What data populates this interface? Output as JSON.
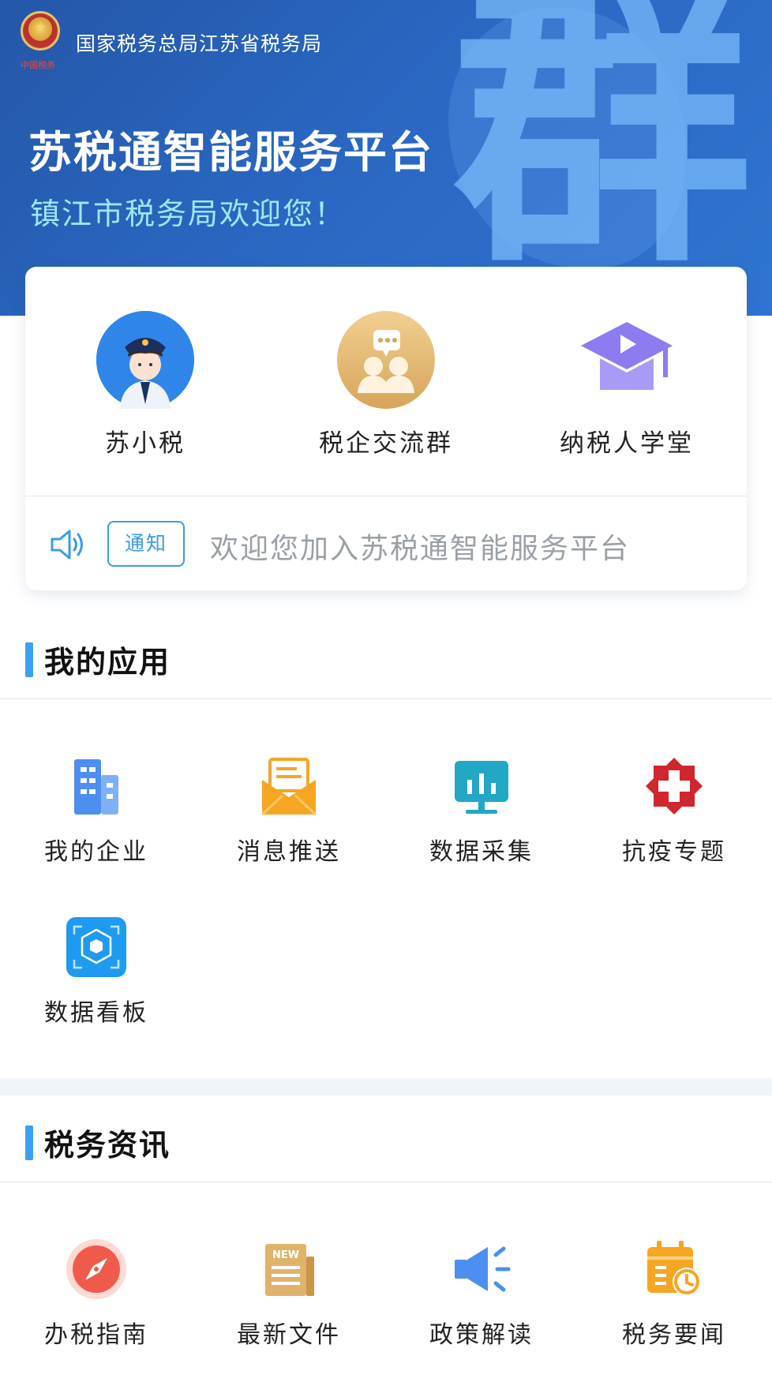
{
  "header": {
    "agency": "国家税务总局江苏省税务局",
    "emblem_caption": "中国税务",
    "platform_title": "苏税通智能服务平台",
    "welcome": "镇江市税务局欢迎您！",
    "deco_char": "群"
  },
  "quick_entries": [
    {
      "label": "苏小税",
      "icon": "tax-officer-avatar-icon"
    },
    {
      "label": "税企交流群",
      "icon": "group-chat-icon"
    },
    {
      "label": "纳税人学堂",
      "icon": "graduation-cap-icon"
    }
  ],
  "notice": {
    "badge": "通知",
    "text": "欢迎您加入苏税通智能服务平台"
  },
  "my_apps": {
    "title": "我的应用",
    "items": [
      {
        "label": "我的企业",
        "icon": "building-icon"
      },
      {
        "label": "消息推送",
        "icon": "envelope-icon"
      },
      {
        "label": "数据采集",
        "icon": "monitor-chart-icon"
      },
      {
        "label": "抗疫专题",
        "icon": "red-cross-icon"
      },
      {
        "label": "数据看板",
        "icon": "data-cube-icon"
      }
    ]
  },
  "tax_news": {
    "title": "税务资讯",
    "new_tag": "NEW",
    "items": [
      {
        "label": "办税指南",
        "icon": "compass-icon"
      },
      {
        "label": "最新文件",
        "icon": "newspaper-icon"
      },
      {
        "label": "政策解读",
        "icon": "megaphone-icon"
      },
      {
        "label": "税务要闻",
        "icon": "calendar-clock-icon"
      }
    ]
  },
  "colors": {
    "banner_blue": "#2a67c2",
    "accent_blue": "#3a9be8",
    "welcome_cyan": "#9ee6f5",
    "orange": "#f6a623",
    "red": "#d0262e"
  }
}
